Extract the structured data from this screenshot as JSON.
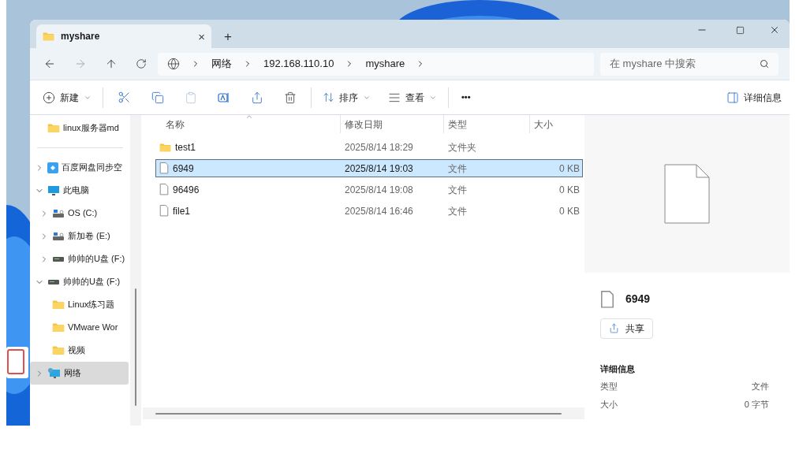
{
  "tab": {
    "title": "myshare",
    "close": "×",
    "new": "+"
  },
  "breadcrumb": [
    "网络",
    "192.168.110.10",
    "myshare"
  ],
  "search": {
    "placeholder": "在 myshare 中搜索"
  },
  "toolbar": {
    "new": "新建",
    "sort": "排序",
    "view": "查看",
    "more": "•••",
    "details": "详细信息"
  },
  "sidebar": {
    "items": [
      {
        "label": "linux服务器md",
        "kind": "folder",
        "selected": false
      },
      {
        "kind": "separator"
      },
      {
        "label": "百度网盘同步空",
        "kind": "cloud",
        "expanded": false,
        "selected": false
      },
      {
        "label": "此电脑",
        "kind": "pc",
        "expanded": true,
        "selected": false,
        "children": [
          {
            "label": "OS (C:)",
            "kind": "drive",
            "expanded": false,
            "selected": false
          },
          {
            "label": "新加卷 (E:)",
            "kind": "drive",
            "expanded": false,
            "selected": false
          },
          {
            "label": "帅帅的U盘 (F:)",
            "kind": "usb",
            "expanded": false,
            "selected": false
          }
        ]
      },
      {
        "label": "帅帅的U盘 (F:)",
        "kind": "usb",
        "expanded": true,
        "selected": false,
        "children": [
          {
            "label": "Linux练习题",
            "kind": "folder",
            "selected": false
          },
          {
            "label": "VMware Wor",
            "kind": "folder",
            "selected": false
          },
          {
            "label": "视频",
            "kind": "folder",
            "selected": false
          }
        ]
      },
      {
        "label": "网络",
        "kind": "network",
        "expanded": false,
        "selected": true
      }
    ]
  },
  "table": {
    "columns": [
      "名称",
      "修改日期",
      "类型",
      "大小"
    ],
    "rows": [
      {
        "name": "test1",
        "date": "2025/8/14 18:29",
        "type": "文件夹",
        "size": "",
        "kind": "folder",
        "selected": false
      },
      {
        "name": "6949",
        "date": "2025/8/14 19:03",
        "type": "文件",
        "size": "0 KB",
        "kind": "file",
        "selected": true
      },
      {
        "name": "96496",
        "date": "2025/8/14 19:08",
        "type": "文件",
        "size": "0 KB",
        "kind": "file",
        "selected": false
      },
      {
        "name": "file1",
        "date": "2025/8/14 16:46",
        "type": "文件",
        "size": "0 KB",
        "kind": "file",
        "selected": false
      }
    ]
  },
  "details": {
    "name": "6949",
    "share": "共享",
    "heading": "详细信息",
    "properties": [
      {
        "label": "类型",
        "value": "文件"
      },
      {
        "label": "大小",
        "value": "0 字节"
      }
    ]
  }
}
